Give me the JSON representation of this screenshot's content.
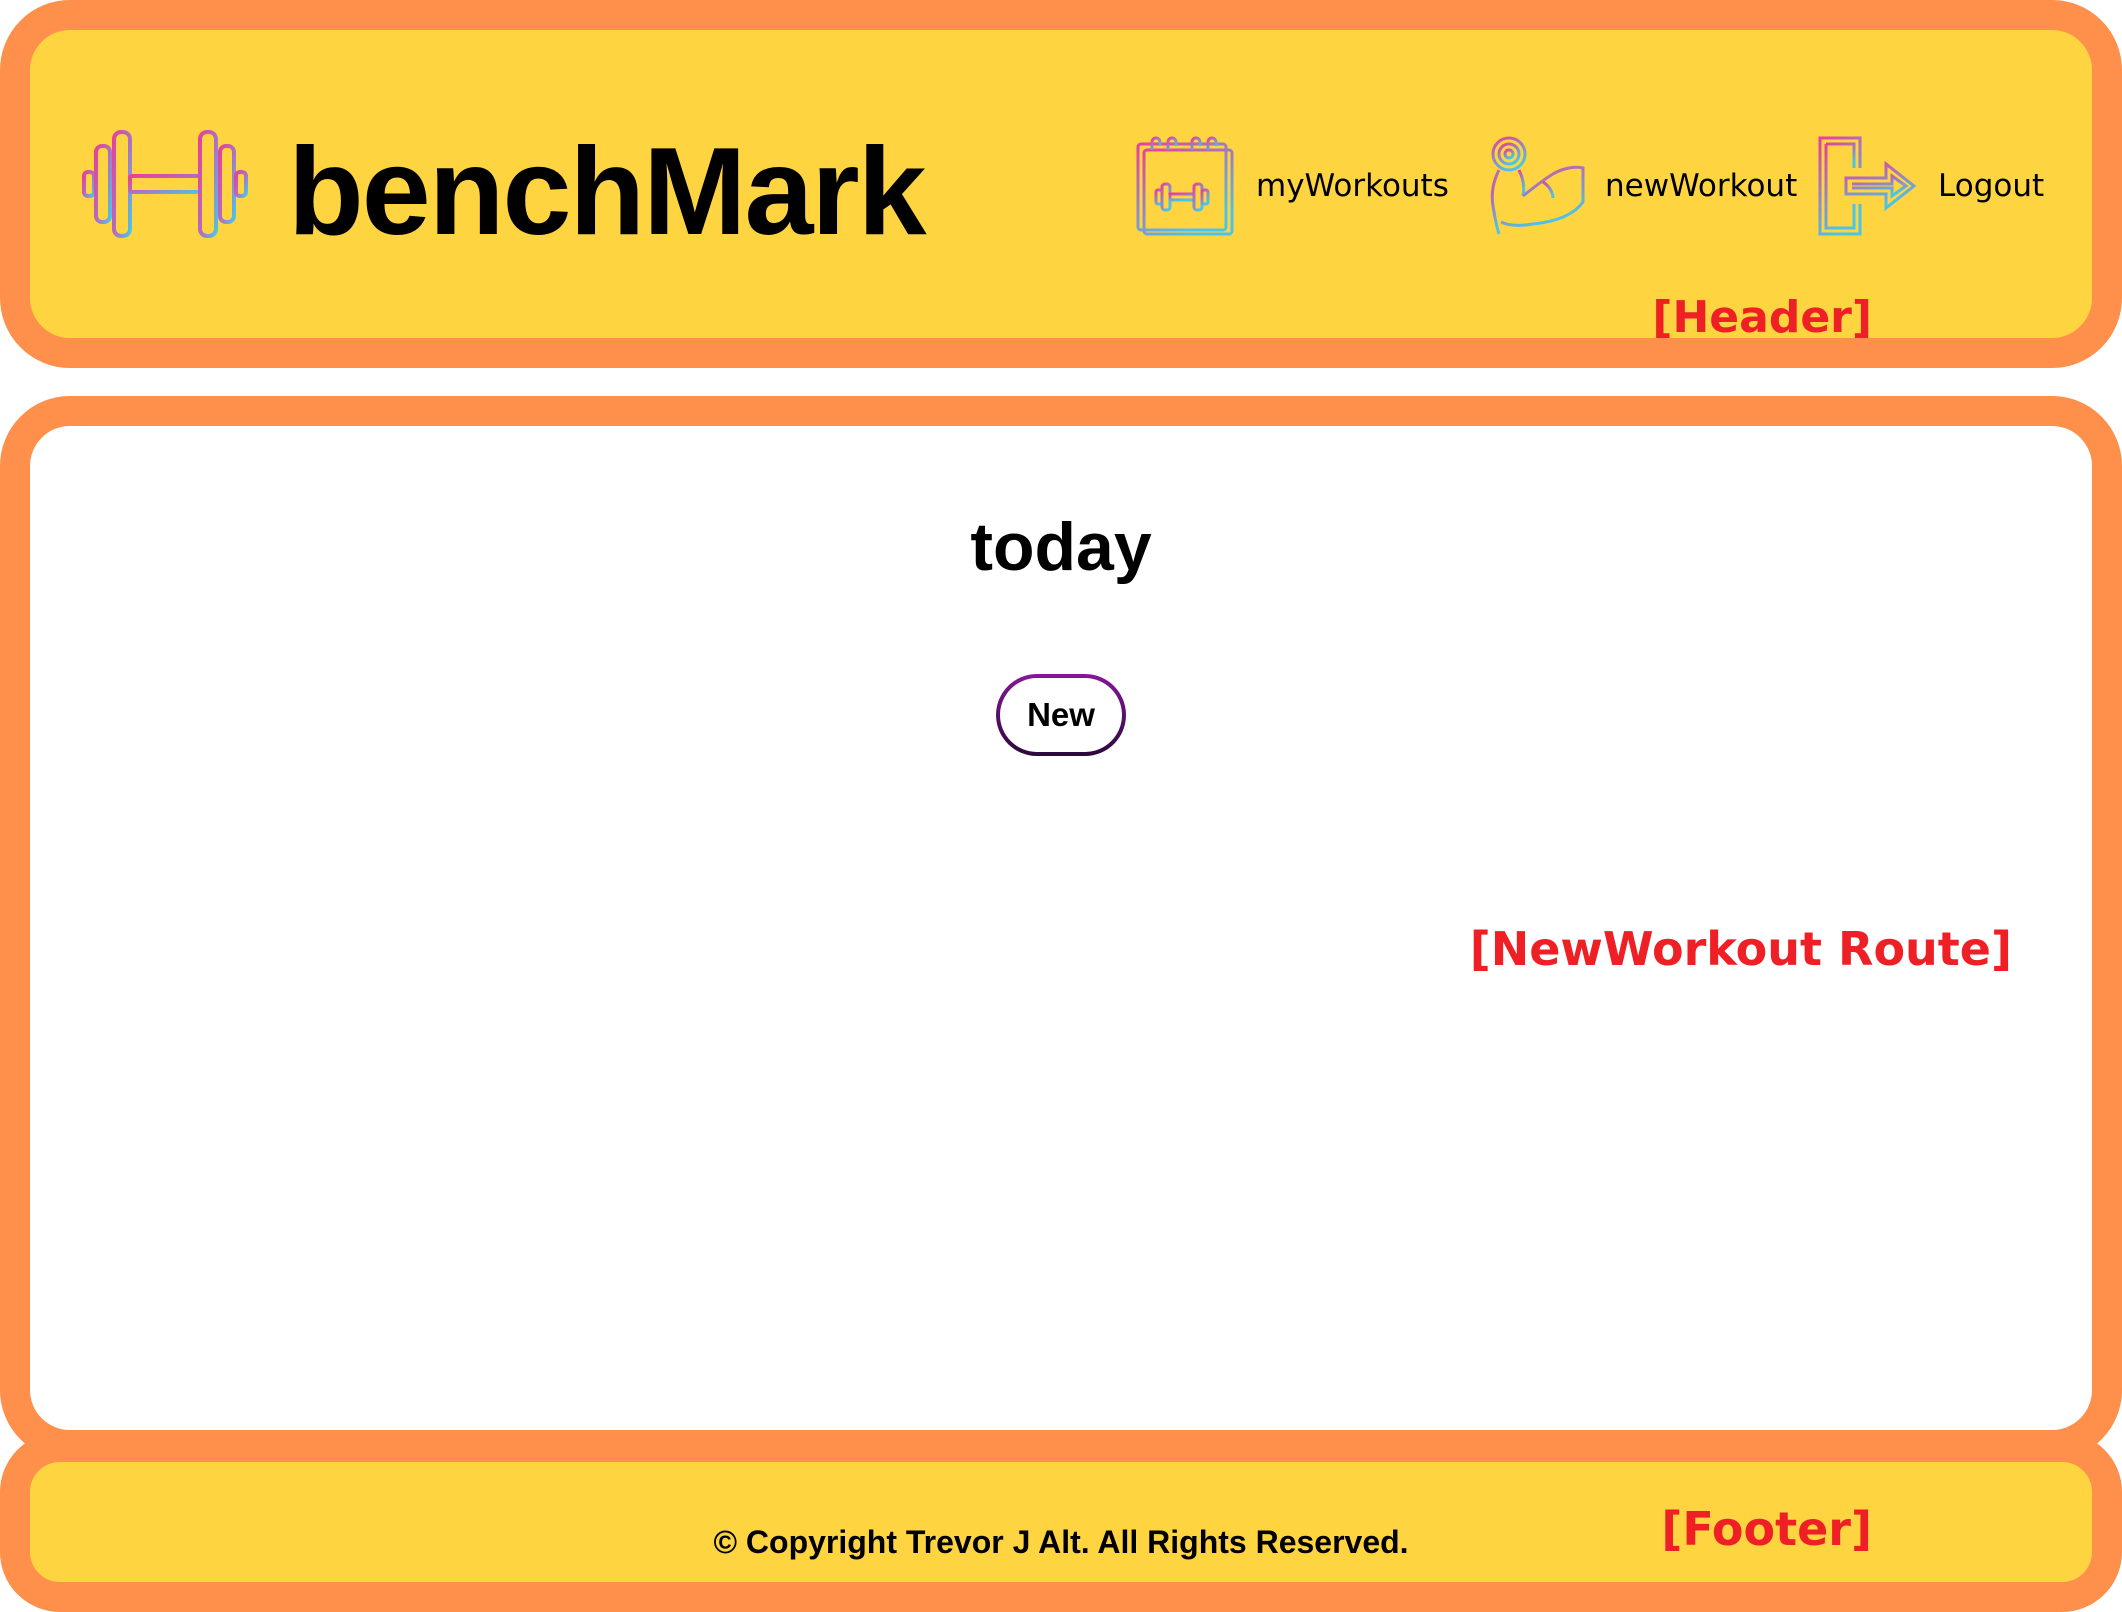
{
  "header": {
    "brand": "benchMark",
    "logo_icon": "dumbbell-icon",
    "nav": [
      {
        "label": "myWorkouts",
        "icon": "calendar-dumbbell-icon"
      },
      {
        "label": "newWorkout",
        "icon": "flexed-arm-dumbbell-icon"
      },
      {
        "label": "Logout",
        "icon": "logout-door-icon"
      }
    ],
    "annotation": "[Header]"
  },
  "main": {
    "title": "today",
    "new_button_label": "New",
    "annotation": "[NewWorkout Route]"
  },
  "footer": {
    "copyright": "© Copyright Trevor J Alt. All Rights Reserved.",
    "annotation": "[Footer]"
  },
  "colors": {
    "frame": "#ff904b",
    "header_bg": "#fed440",
    "annotation": "#ee2025",
    "icon_gradient_start": "#e8409a",
    "icon_gradient_end": "#4cc4e8",
    "button_border_top": "#87169b"
  }
}
